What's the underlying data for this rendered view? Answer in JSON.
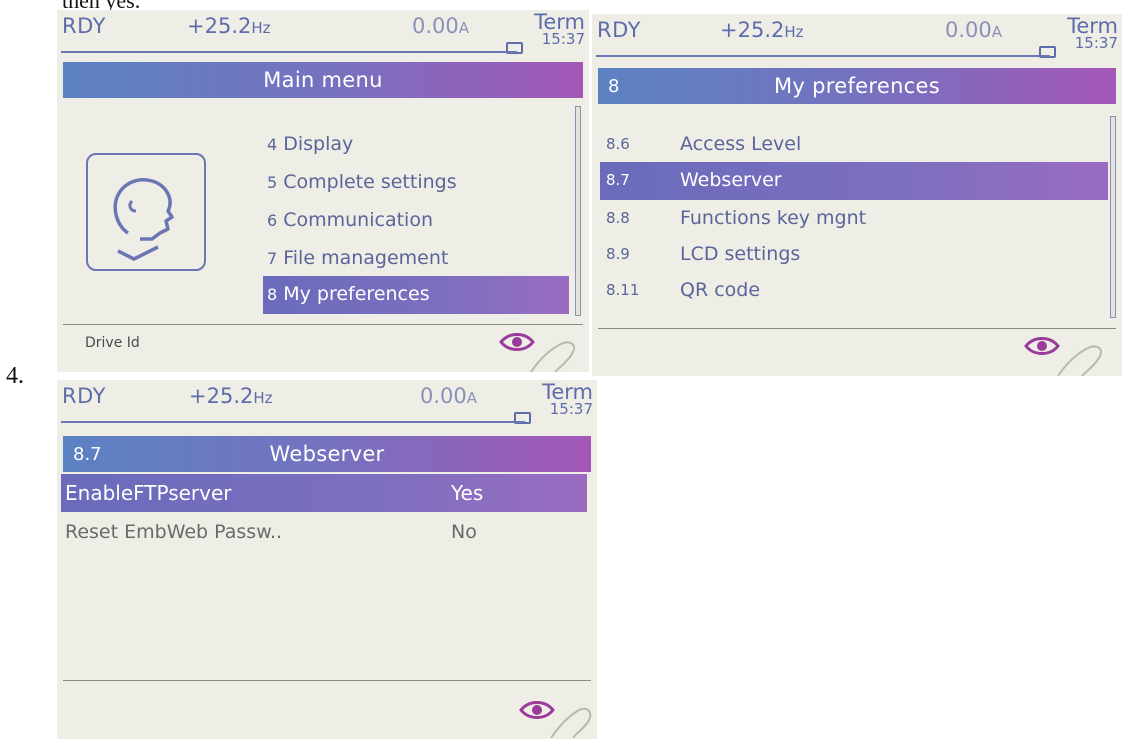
{
  "document": {
    "cut_text": "then yes.",
    "step_number": "4."
  },
  "status_bar": {
    "state": "RDY",
    "frequency": "+25.2",
    "frequency_unit": "Hz",
    "current": "0.00",
    "current_unit": "A",
    "channel": "Term",
    "clock": "15:37"
  },
  "main_menu": {
    "title": "Main menu",
    "items": [
      {
        "number": "4",
        "label": "Display"
      },
      {
        "number": "5",
        "label": "Complete settings"
      },
      {
        "number": "6",
        "label": "Communication"
      },
      {
        "number": "7",
        "label": "File management"
      },
      {
        "number": "8",
        "label": "My preferences",
        "selected": true
      }
    ],
    "footer_label": "Drive Id"
  },
  "my_preferences": {
    "number": "8",
    "title": "My preferences",
    "items": [
      {
        "number": "8.6",
        "label": "Access Level"
      },
      {
        "number": "8.7",
        "label": "Webserver",
        "selected": true
      },
      {
        "number": "8.8",
        "label": "Functions key mgnt"
      },
      {
        "number": "8.9",
        "label": "LCD settings"
      },
      {
        "number": "8.11",
        "label": "QR code"
      }
    ]
  },
  "webserver": {
    "number": "8.7",
    "title": "Webserver",
    "params": [
      {
        "label": "EnableFTPserver",
        "value": "Yes",
        "selected": true
      },
      {
        "label": "Reset EmbWeb Passw..",
        "value": "No"
      }
    ]
  },
  "icons": {
    "battery": "battery-icon",
    "drive_head": "drive-head-icon",
    "eye": "eye-icon"
  },
  "colors": {
    "screen_bg": "#eeeee7",
    "title_gradient_start": "#5b82c2",
    "title_gradient_end": "#a357b6",
    "text_blue": "#5a6599"
  }
}
